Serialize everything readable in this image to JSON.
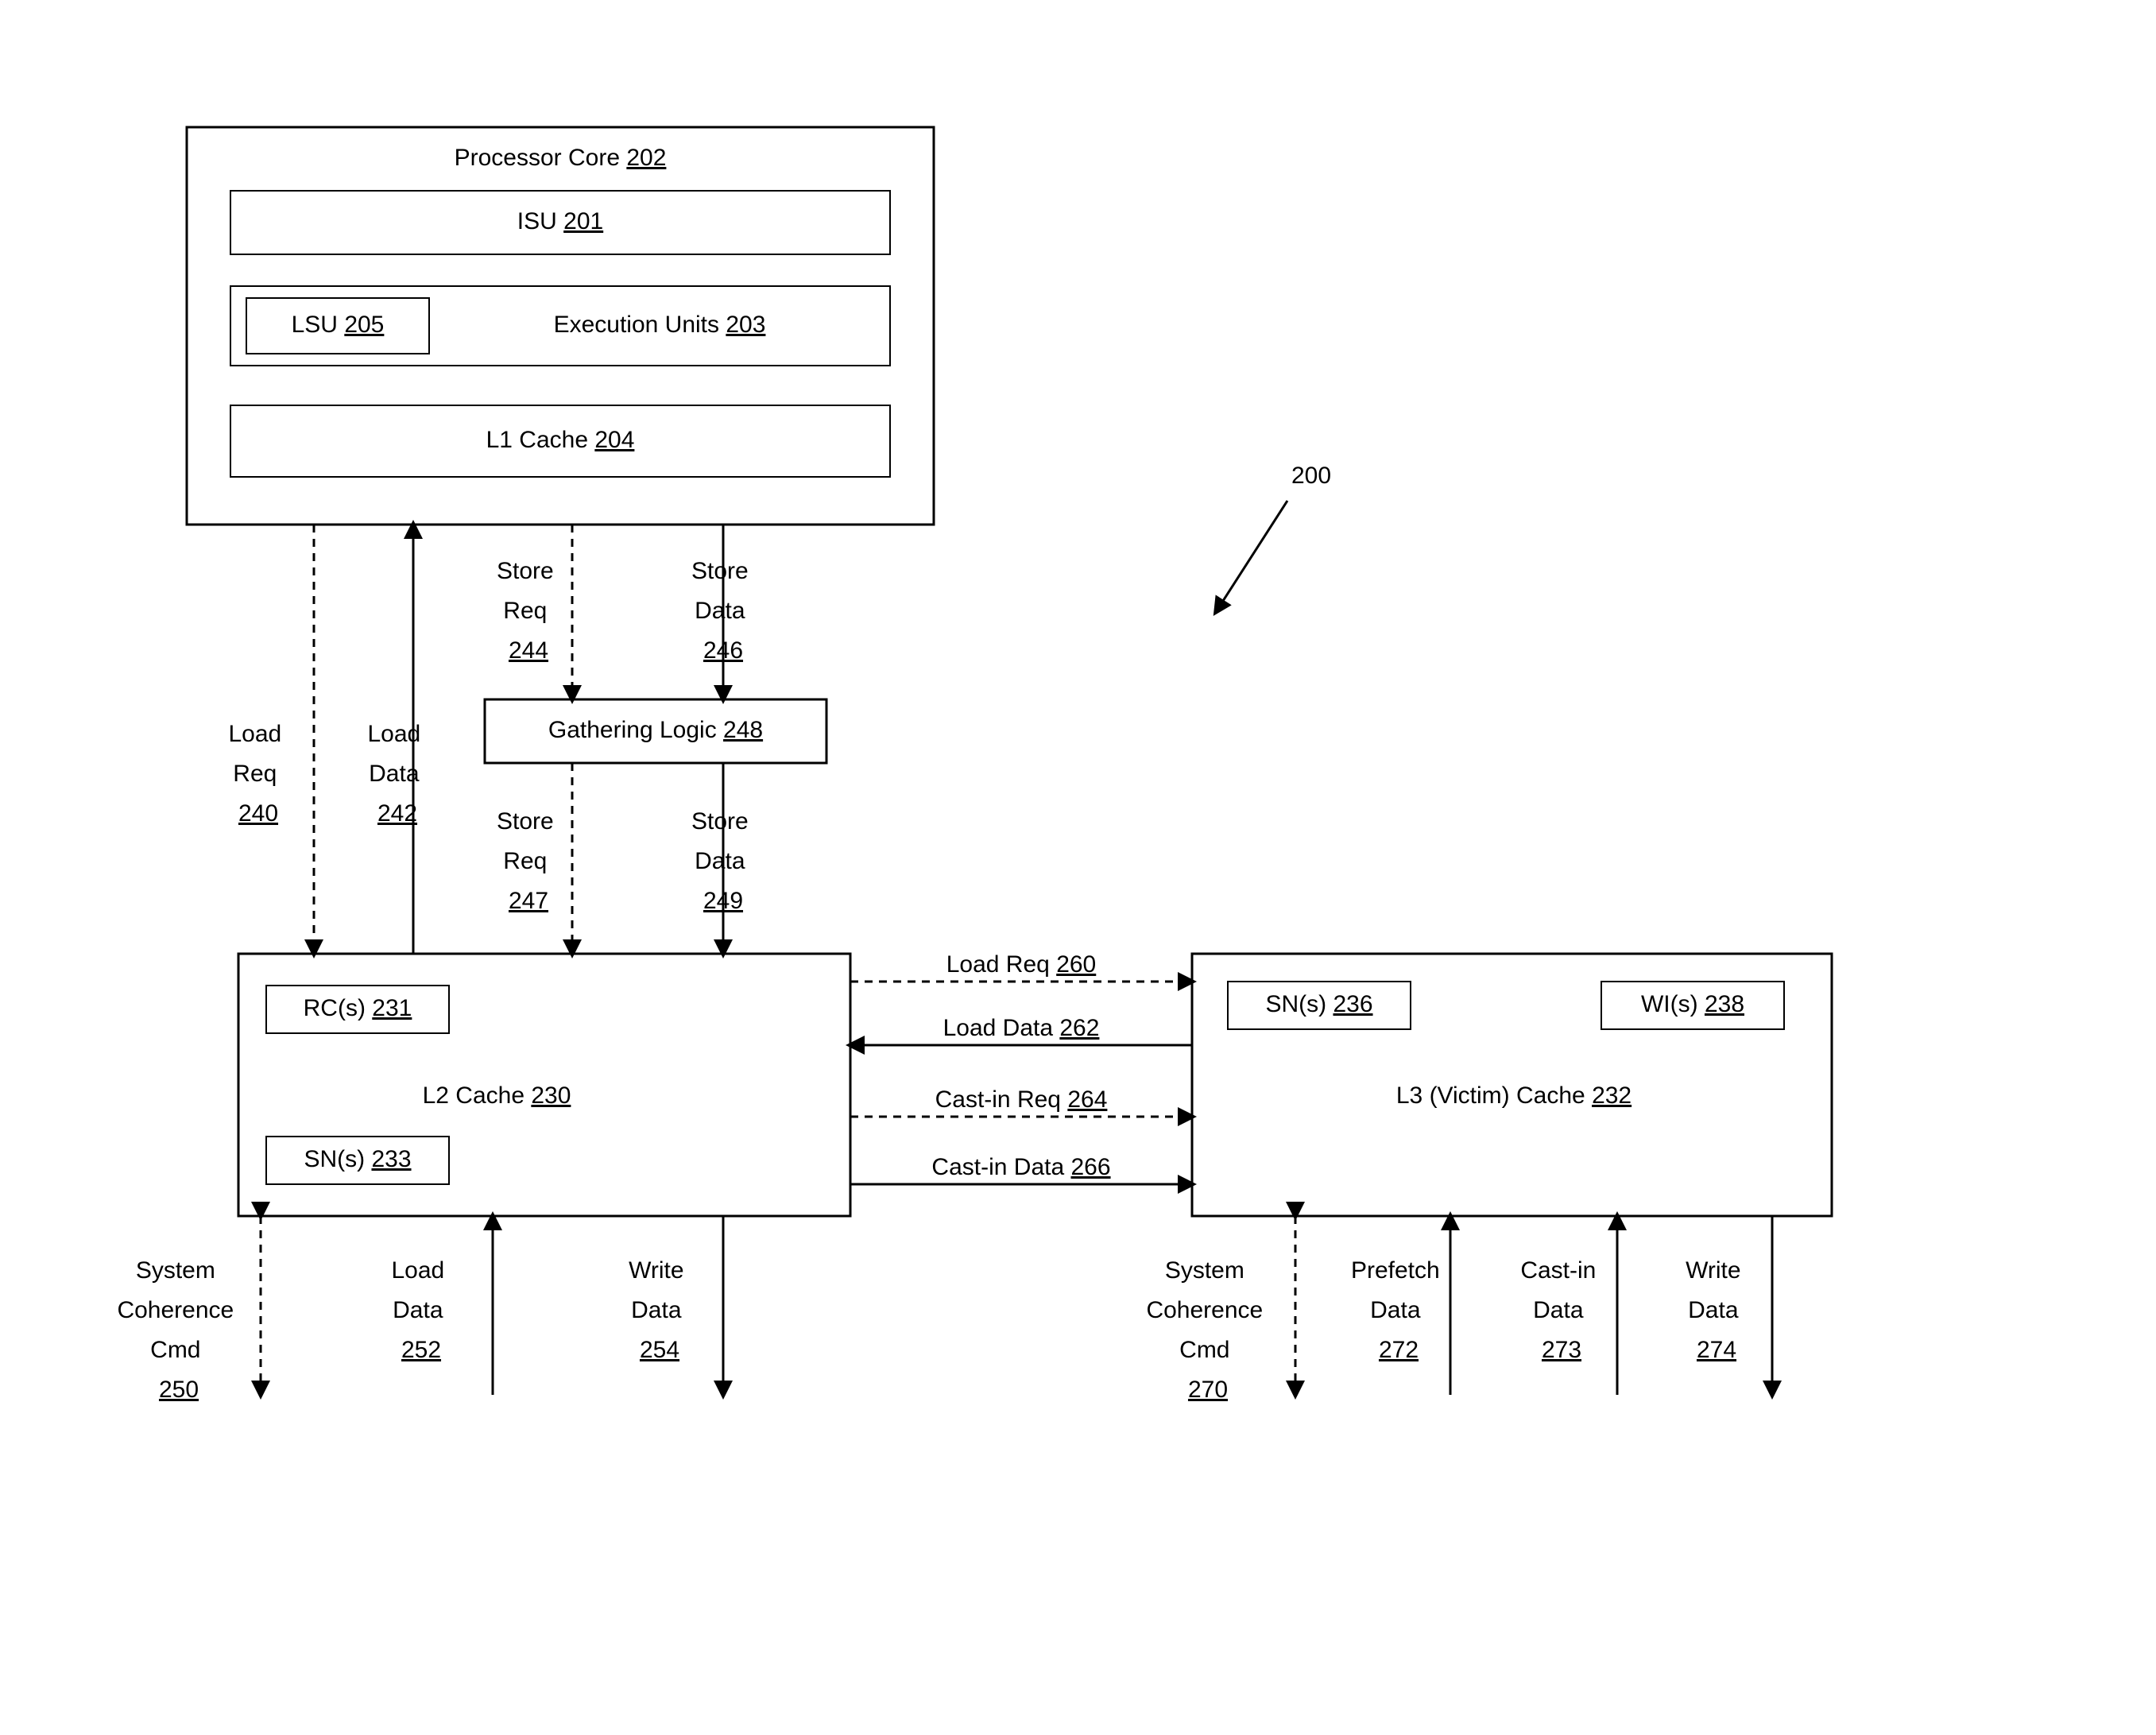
{
  "figureRef": "200",
  "core": {
    "title_prefix": "Processor Core ",
    "title_num": "202",
    "isu_prefix": "ISU ",
    "isu_num": "201",
    "lsu_prefix": "LSU ",
    "lsu_num": "205",
    "exec_prefix": "Execution Units ",
    "exec_num": "203",
    "l1_prefix": "L1 Cache ",
    "l1_num": "204"
  },
  "gathering": {
    "prefix": "Gathering Logic ",
    "num": "248"
  },
  "l2": {
    "title_prefix": "L2 Cache ",
    "title_num": "230",
    "rc_prefix": "RC(s) ",
    "rc_num": "231",
    "sn_prefix": "SN(s) ",
    "sn_num": "233"
  },
  "l3": {
    "title_prefix": "L3 (Victim) Cache ",
    "title_num": "232",
    "sn_prefix": "SN(s) ",
    "sn_num": "236",
    "wi_prefix": "WI(s) ",
    "wi_num": "238"
  },
  "signals": {
    "loadReq_up": {
      "l1": "Load",
      "l2": "Req",
      "num": "240"
    },
    "loadData_up": {
      "l1": "Load",
      "l2": "Data",
      "num": "242"
    },
    "storeReq_top": {
      "l1": "Store",
      "l2": "Req",
      "num": "244"
    },
    "storeData_top": {
      "l1": "Store",
      "l2": "Data",
      "num": "246"
    },
    "storeReq_bot": {
      "l1": "Store",
      "l2": "Req",
      "num": "247"
    },
    "storeData_bot": {
      "l1": "Store",
      "l2": "Data",
      "num": "249"
    },
    "loadReq_lr": {
      "label": "Load Req ",
      "num": "260"
    },
    "loadData_lr": {
      "label": "Load Data ",
      "num": "262"
    },
    "castinReq": {
      "label": "Cast-in Req ",
      "num": "264"
    },
    "castinData": {
      "label": "Cast-in Data ",
      "num": "266"
    },
    "l2_syscmd": {
      "l1": "System",
      "l2": "Coherence",
      "l3": "Cmd",
      "num": "250"
    },
    "l2_loadData": {
      "l1": "Load",
      "l2": "Data",
      "num": "252"
    },
    "l2_writeData": {
      "l1": "Write",
      "l2": "Data",
      "num": "254"
    },
    "l3_syscmd": {
      "l1": "System",
      "l2": "Coherence",
      "l3": "Cmd",
      "num": "270"
    },
    "l3_prefetch": {
      "l1": "Prefetch",
      "l2": "Data",
      "num": "272"
    },
    "l3_castin": {
      "l1": "Cast-in",
      "l2": "Data",
      "num": "273"
    },
    "l3_writeData": {
      "l1": "Write",
      "l2": "Data",
      "num": "274"
    }
  }
}
